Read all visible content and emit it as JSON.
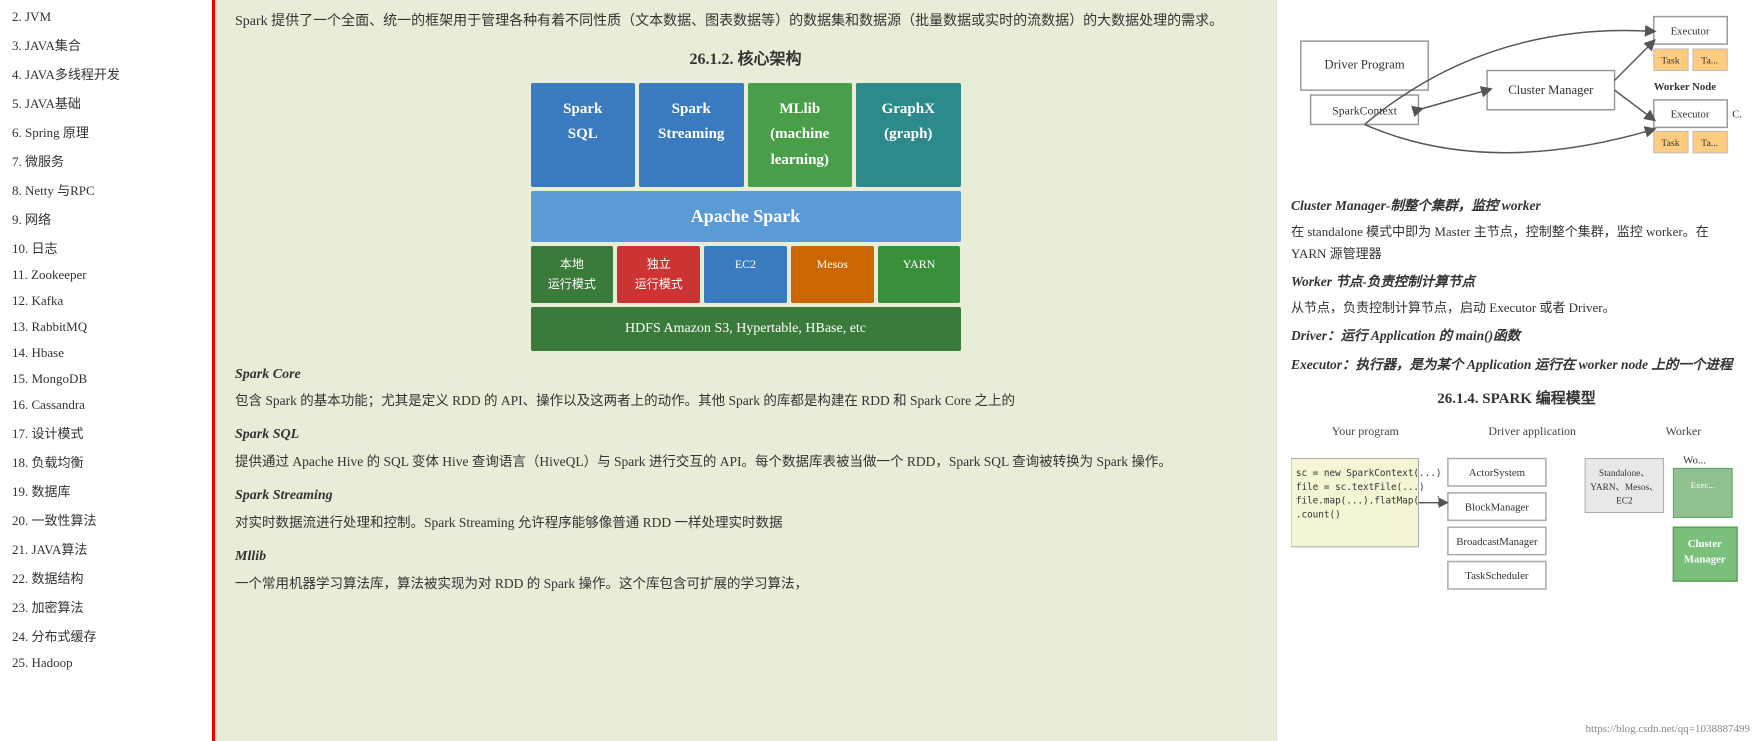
{
  "sidebar": {
    "items": [
      {
        "id": "jvm",
        "label": "2. JVM"
      },
      {
        "id": "java-collections",
        "label": "3. JAVA集合"
      },
      {
        "id": "java-thread",
        "label": "4. JAVA多线程开发"
      },
      {
        "id": "java-basic",
        "label": "5. JAVA基础"
      },
      {
        "id": "spring",
        "label": "6. Spring 原理"
      },
      {
        "id": "microservice",
        "label": "7.  微服务"
      },
      {
        "id": "netty-rpc",
        "label": "8. Netty 与RPC"
      },
      {
        "id": "network",
        "label": "9. 网络"
      },
      {
        "id": "log",
        "label": "10. 日志"
      },
      {
        "id": "zookeeper",
        "label": "11. Zookeeper"
      },
      {
        "id": "kafka",
        "label": "12. Kafka"
      },
      {
        "id": "rabbitmq",
        "label": "13. RabbitMQ"
      },
      {
        "id": "hbase",
        "label": "14. Hbase"
      },
      {
        "id": "mongodb",
        "label": "15. MongoDB"
      },
      {
        "id": "cassandra",
        "label": "16. Cassandra"
      },
      {
        "id": "design-patterns",
        "label": "17. 设计模式"
      },
      {
        "id": "load-balance",
        "label": "18. 负载均衡"
      },
      {
        "id": "database",
        "label": "19. 数据库"
      },
      {
        "id": "consistency",
        "label": "20. 一致性算法"
      },
      {
        "id": "java-algo",
        "label": "21. JAVA算法"
      },
      {
        "id": "data-structure",
        "label": "22. 数据结构"
      },
      {
        "id": "crypto",
        "label": "23. 加密算法"
      },
      {
        "id": "distributed-cache",
        "label": "24. 分布式缓存"
      },
      {
        "id": "hadoop",
        "label": "25. Hadoop"
      }
    ]
  },
  "main": {
    "intro_text": "Spark 提供了一个全面、统一的框架用于管理各种有着不同性质（文本数据、图表数据等）的数据集和数据源（批量数据或实时的流数据）的大数据处理的需求。",
    "section_title": "26.1.2.   核心架构",
    "diagram": {
      "boxes": [
        {
          "label": "Spark\nSQL",
          "color": "blue"
        },
        {
          "label": "Spark\nStreaming",
          "color": "blue"
        },
        {
          "label": "MLlib\n(machine\nlearning)",
          "color": "green"
        },
        {
          "label": "GraphX\n(graph)",
          "color": "teal"
        }
      ],
      "core_label": "Apache Spark",
      "modes": [
        {
          "label": "本地\n运行模式",
          "color": "local"
        },
        {
          "label": "独立\n运行模式",
          "color": "standalone"
        },
        {
          "label": "EC2",
          "color": "ec2"
        },
        {
          "label": "Mesos",
          "color": "mesos"
        },
        {
          "label": "YARN",
          "color": "yarn"
        }
      ],
      "storage_label": "HDFS    Amazon S3, Hypertable, HBase, etc"
    },
    "descriptions": [
      {
        "title": "Spark Core",
        "text": "包含 Spark 的基本功能；尤其是定义 RDD 的 API、操作以及这两者上的动作。其他 Spark 的库都是构建在 RDD 和 Spark Core 之上的"
      },
      {
        "title": "Spark SQL",
        "text": "提供通过 Apache Hive 的 SQL 变体 Hive 查询语言（HiveQL）与 Spark 进行交互的 API。每个数据库表被当做一个 RDD，Spark SQL 查询被转换为 Spark 操作。"
      },
      {
        "title": "Spark Streaming",
        "text": "对实时数据流进行处理和控制。Spark Streaming 允许程序能够像普通 RDD 一样处理实时数据"
      },
      {
        "title": "Mllib",
        "text": "一个常用机器学习算法库，算法被实现为对 RDD 的 Spark 操作。这个库包含可扩展的学习算法，"
      }
    ]
  },
  "right_panel": {
    "cluster_manager_title": "Cluster Manager-制整个集群，监控 worker",
    "cluster_manager_desc": "在 standalone 模式中即为 Master 主节点，控制整个集群，监控 worker。在 YARN 源管理器",
    "worker_title": "Worker 节点-负责控制计算节点",
    "worker_desc": "从节点，负责控制计算节点，启动 Executor 或者 Driver。",
    "driver_title": "Driver：运行 Application 的 main()函数",
    "executor_title": "Executor：执行器，是为某个 Application 运行在 worker node 上的一个进程",
    "section_title": "26.1.4.    SPARK 编程模型",
    "prog_headers": [
      "Your program",
      "Driver application",
      "Worker"
    ],
    "code_snippet": "sc = new SparkContext(...)\nfile = sc.textFile(...)\nfile.map(...).flatMap(...)\n.count()",
    "standalone_label": "Standalone、\nYARN、Mesos、\nEC2",
    "watermark": "https://blog.csdn.net/qq=1038887499"
  }
}
